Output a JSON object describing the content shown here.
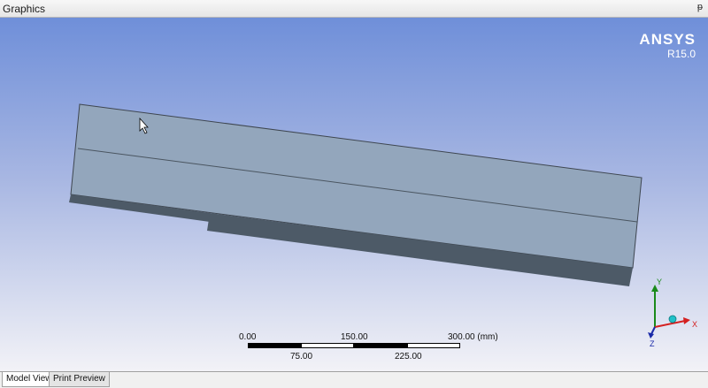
{
  "window": {
    "title": "Graphics",
    "pin_glyph": "ᵽ"
  },
  "logo": {
    "brand": "ANSYS",
    "version": "R15.0"
  },
  "scale_bar": {
    "top_labels": [
      "0.00",
      "150.00",
      "300.00 (mm)"
    ],
    "bottom_labels": [
      "75.00",
      "225.00"
    ]
  },
  "triad": {
    "x_label": "X",
    "y_label": "Y",
    "z_label": "Z"
  },
  "tabs": [
    {
      "label": "Model View"
    },
    {
      "label": "Print Preview"
    }
  ],
  "colors": {
    "viewport_top": "#6f8fd9",
    "viewport_bottom": "#f2f2f7",
    "part_top_face": "#93a6bc",
    "part_side_face": "#4d5a67",
    "axis_x": "#d42020",
    "axis_y": "#1a8a1a",
    "axis_z": "#1a2aa8"
  }
}
